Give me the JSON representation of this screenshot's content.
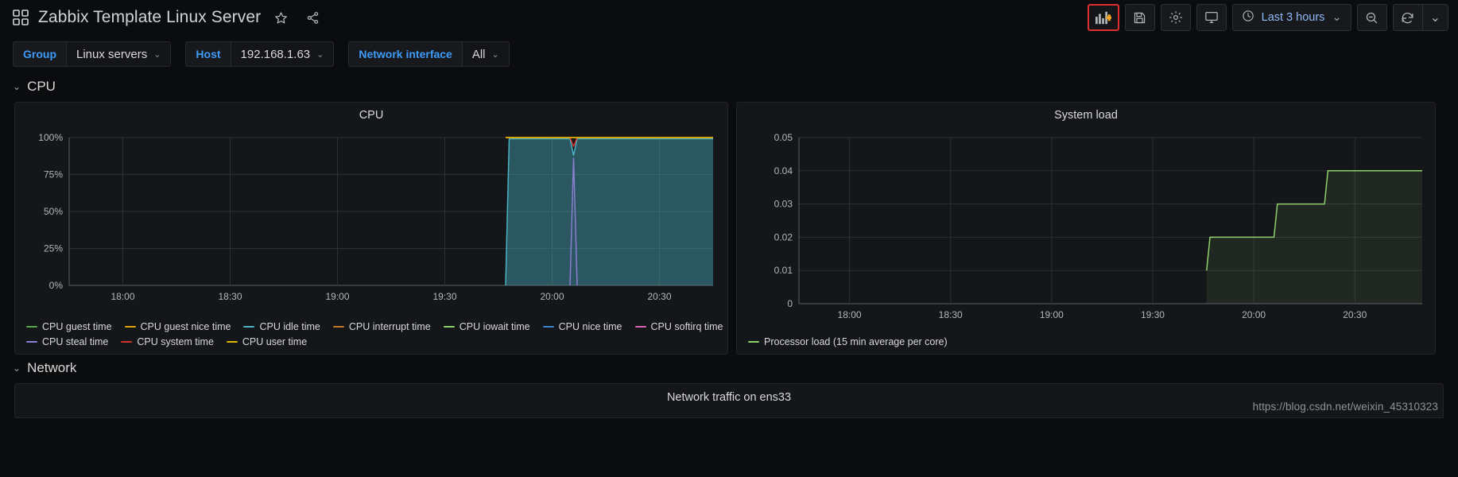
{
  "topnav": {
    "grid_icon": "dashboard-grid-icon",
    "title": "Zabbix Template Linux Server",
    "star_icon": "star-icon",
    "share_icon": "share-icon",
    "add_panel_label": "add-panel-icon",
    "save_label": "save-icon",
    "settings_label": "settings-gear-icon",
    "tv_label": "tv-mode-icon",
    "time_range": "Last 3 hours",
    "time_icon": "clock-icon",
    "chevron": "⌄",
    "zoom_out_icon": "zoom-out-icon",
    "refresh_icon": "refresh-icon",
    "refresh_chevron": "⌄",
    "highlight_color": "#e02f2f",
    "accent_color": "#3d9bfa"
  },
  "variables": [
    {
      "label": "Group",
      "value": "Linux servers",
      "chevron": "⌄"
    },
    {
      "label": "Host",
      "value": "192.168.1.63",
      "chevron": "⌄"
    },
    {
      "label": "Network interface",
      "value": "All",
      "chevron": "⌄"
    }
  ],
  "rows": [
    {
      "title": "CPU",
      "chevron": "⌄"
    },
    {
      "title": "Network",
      "chevron": "⌄"
    }
  ],
  "bottom_panel": {
    "title": "Network traffic on ens33"
  },
  "watermark": "https://blog.csdn.net/weixin_45310323",
  "chart_data": [
    {
      "type": "area",
      "title": "CPU",
      "xlabel": "",
      "ylabel": "",
      "ylim": [
        0,
        100
      ],
      "yticks": [
        "0%",
        "25%",
        "50%",
        "75%",
        "100%"
      ],
      "ytick_values": [
        0,
        25,
        50,
        75,
        100
      ],
      "xticks": [
        "18:00",
        "18:30",
        "19:00",
        "19:30",
        "20:00",
        "20:30"
      ],
      "xtick_values": [
        1080,
        1110,
        1140,
        1170,
        1200,
        1230
      ],
      "xlim": [
        1065,
        1245
      ],
      "grid": true,
      "legend_position": "bottom",
      "series": [
        {
          "name": "CPU guest time",
          "color": "#56a64b",
          "values": []
        },
        {
          "name": "CPU guest nice time",
          "color": "#d9a40e",
          "values": []
        },
        {
          "name": "CPU idle time",
          "color": "#4ab3c4",
          "values": [
            {
              "x": 1187,
              "y": 0
            },
            {
              "x": 1188,
              "y": 99.2
            },
            {
              "x": 1205,
              "y": 99.2
            },
            {
              "x": 1206,
              "y": 88
            },
            {
              "x": 1207,
              "y": 99.2
            },
            {
              "x": 1245,
              "y": 99.2
            }
          ]
        },
        {
          "name": "CPU interrupt time",
          "color": "#c4762a",
          "values": []
        },
        {
          "name": "CPU iowait time",
          "color": "#8fd26a",
          "values": []
        },
        {
          "name": "CPU nice time",
          "color": "#3b82d0",
          "values": []
        },
        {
          "name": "CPU softirq time",
          "color": "#d863b5",
          "values": []
        },
        {
          "name": "CPU steal time",
          "color": "#8a7fd0",
          "values": [
            {
              "x": 1205,
              "y": 0
            },
            {
              "x": 1206,
              "y": 86
            },
            {
              "x": 1207,
              "y": 0
            }
          ]
        },
        {
          "name": "CPU system time",
          "color": "#d0342c",
          "values": [
            {
              "x": 1187,
              "y": 100
            },
            {
              "x": 1205,
              "y": 100
            },
            {
              "x": 1206,
              "y": 94
            },
            {
              "x": 1207,
              "y": 100
            },
            {
              "x": 1245,
              "y": 100
            }
          ]
        },
        {
          "name": "CPU user time",
          "color": "#e0b400",
          "values": [
            {
              "x": 1187,
              "y": 100
            },
            {
              "x": 1245,
              "y": 100
            }
          ]
        }
      ]
    },
    {
      "type": "area",
      "title": "System load",
      "xlabel": "",
      "ylabel": "",
      "ylim": [
        0,
        0.05
      ],
      "yticks": [
        "0",
        "0.01",
        "0.02",
        "0.03",
        "0.04",
        "0.05"
      ],
      "ytick_values": [
        0,
        0.01,
        0.02,
        0.03,
        0.04,
        0.05
      ],
      "xticks": [
        "18:00",
        "18:30",
        "19:00",
        "19:30",
        "20:00",
        "20:30"
      ],
      "xtick_values": [
        1080,
        1110,
        1140,
        1170,
        1200,
        1230
      ],
      "xlim": [
        1065,
        1250
      ],
      "grid": true,
      "legend_position": "bottom",
      "series": [
        {
          "name": "Processor load (15 min average per core)",
          "color": "#8fd26a",
          "values": [
            {
              "x": 1186,
              "y": 0.01
            },
            {
              "x": 1187,
              "y": 0.02
            },
            {
              "x": 1206,
              "y": 0.02
            },
            {
              "x": 1207,
              "y": 0.03
            },
            {
              "x": 1221,
              "y": 0.03
            },
            {
              "x": 1222,
              "y": 0.04
            },
            {
              "x": 1250,
              "y": 0.04
            }
          ]
        }
      ]
    }
  ]
}
